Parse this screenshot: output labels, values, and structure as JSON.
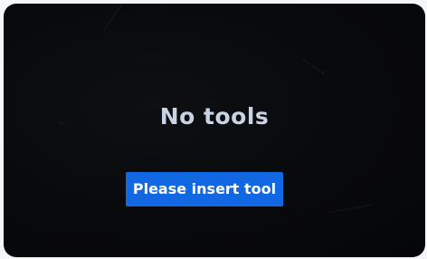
{
  "screen": {
    "title": "No tools",
    "button_label": "Please insert tool",
    "background_color": "#08090b",
    "button_color": "#1268e3",
    "title_color": "#c8d3e4"
  }
}
